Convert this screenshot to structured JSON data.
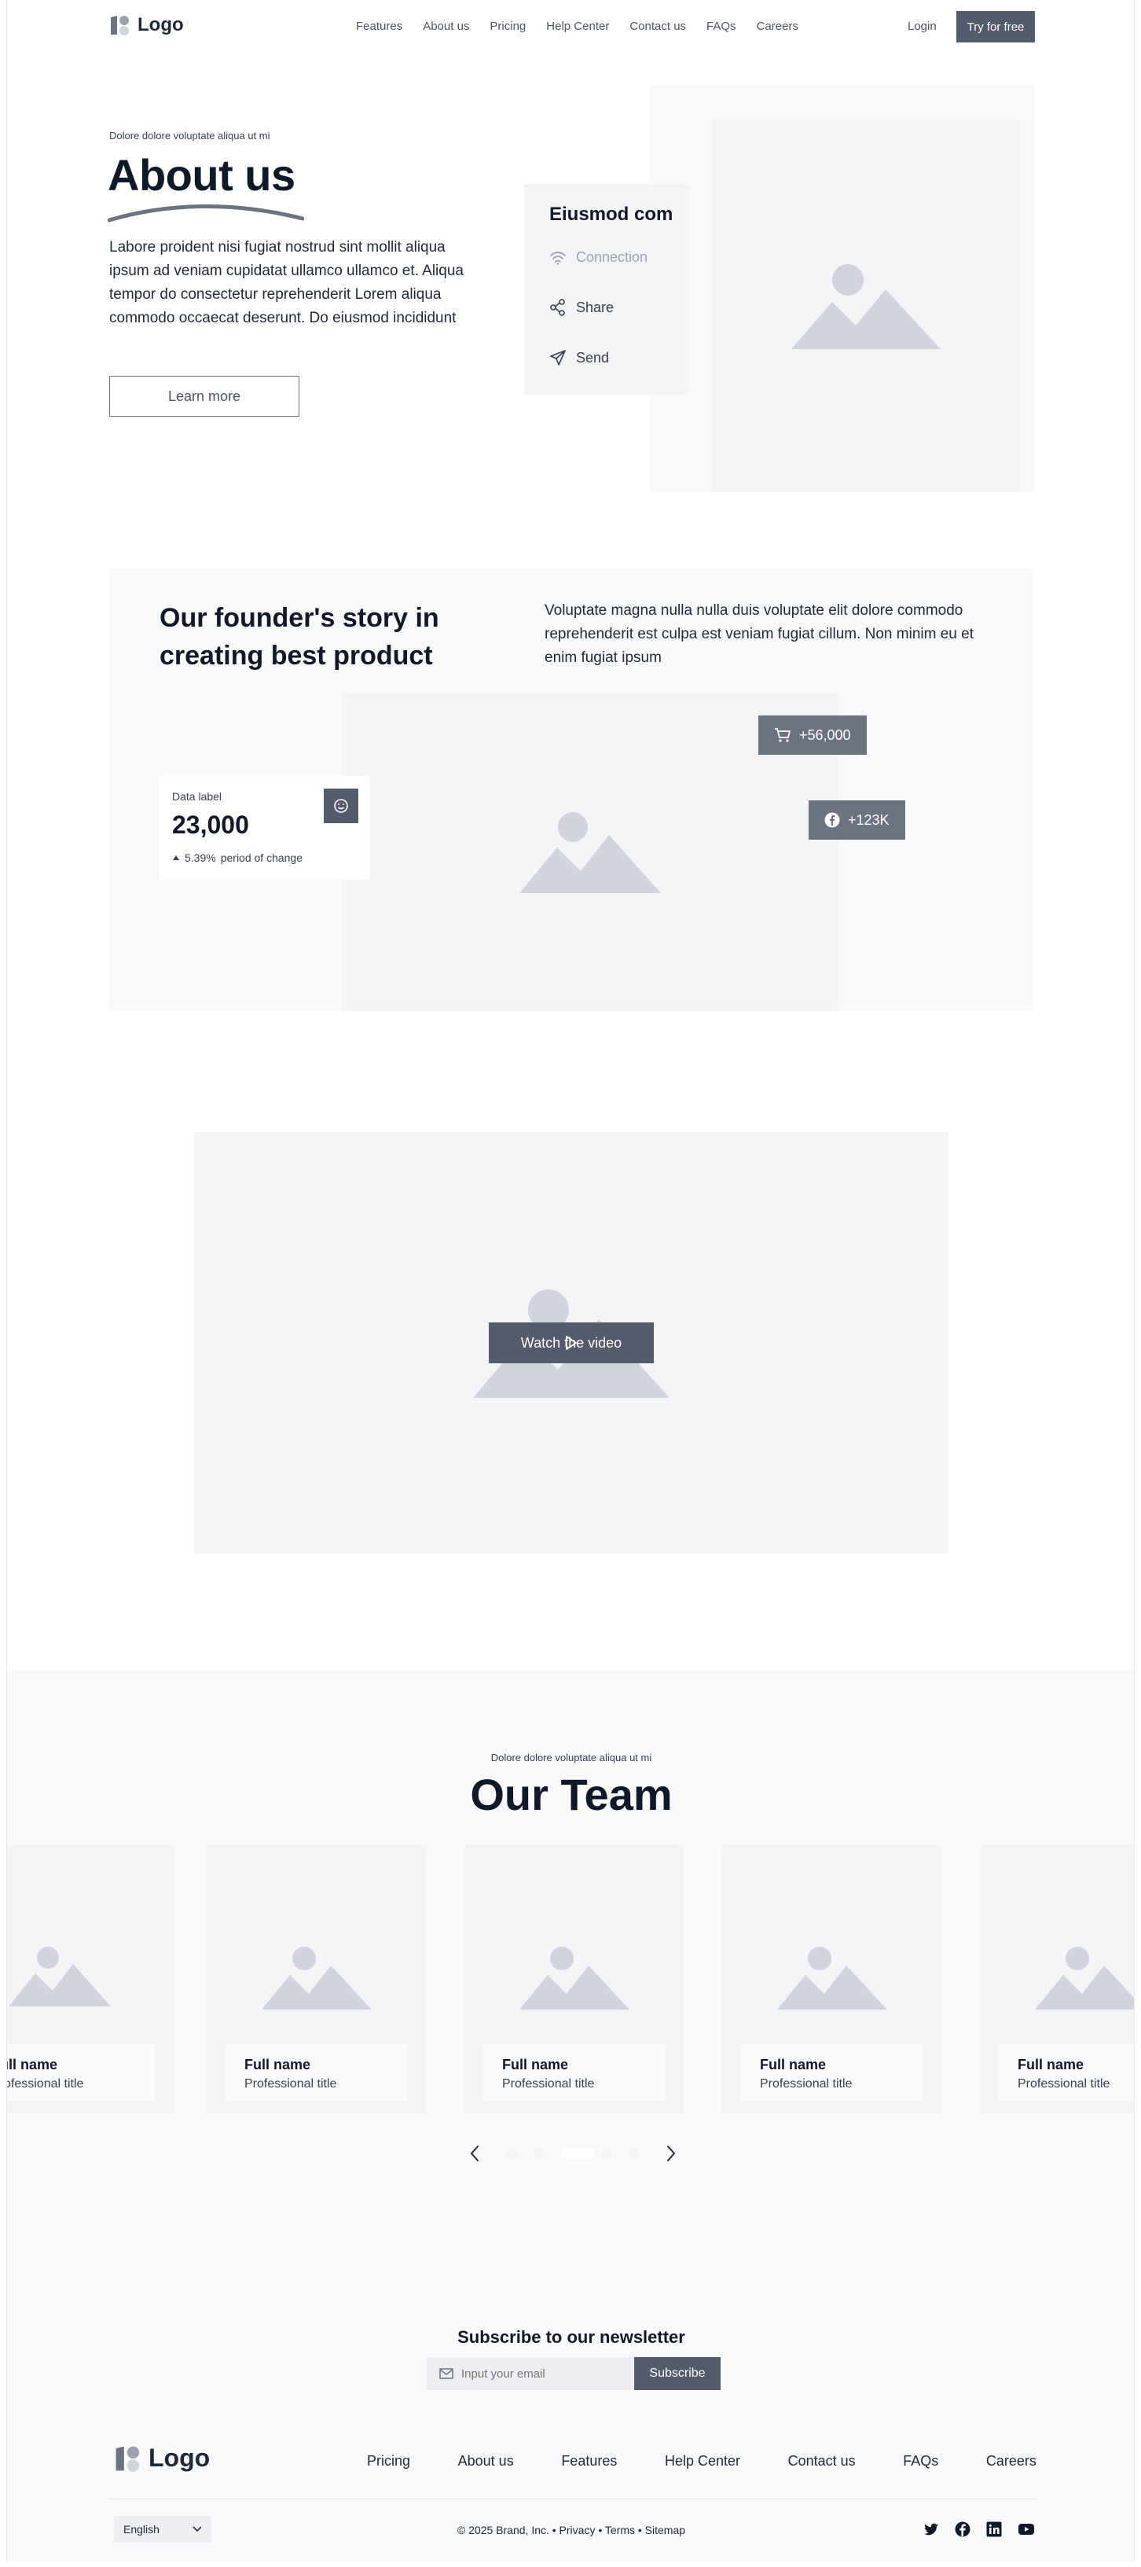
{
  "nav": {
    "logo": "Logo",
    "links": [
      "Features",
      "About us",
      "Pricing",
      "Help Center",
      "Contact us",
      "FAQs",
      "Careers"
    ],
    "login": "Login",
    "cta": "Try for free"
  },
  "hero": {
    "eyebrow": "Dolore dolore voluptate aliqua ut mi",
    "title": "About us",
    "body": "Labore proident nisi fugiat nostrud sint mollit aliqua ipsum ad veniam cupidatat ullamco ullamco et. Aliqua tempor do consectetur reprehenderit Lorem aliqua commodo occaecat deserunt. Do eiusmod incididunt",
    "button": "Learn more",
    "card": {
      "title": "Eiusmod com",
      "items": [
        {
          "icon": "wifi-icon",
          "label": "Connection"
        },
        {
          "icon": "share-icon",
          "label": "Share"
        },
        {
          "icon": "send-icon",
          "label": "Send"
        }
      ]
    }
  },
  "founder": {
    "title": "Our founder's story in creating best product",
    "body": "Voluptate magna nulla nulla duis voluptate elit dolore commodo reprehenderit est culpa est veniam fugiat cillum. Non minim eu et enim fugiat ipsum",
    "stat": {
      "label": "Data label",
      "value": "23,000",
      "change": "5.39%",
      "change_text": "period of change"
    },
    "pill_cart": "+56,000",
    "pill_facebook": "+123K"
  },
  "video": {
    "button": "Watch the video"
  },
  "team": {
    "eyebrow": "Dolore dolore voluptate aliqua ut mi",
    "title": "Our Team",
    "members": [
      {
        "name": "Full name",
        "title": "Professional title"
      },
      {
        "name": "Full name",
        "title": "Professional title"
      },
      {
        "name": "Full name",
        "title": "Professional title"
      },
      {
        "name": "Full name",
        "title": "Professional title"
      },
      {
        "name": "Full name",
        "title": "Professional title"
      }
    ],
    "carousel_active_index": 2
  },
  "newsletter": {
    "title": "Subscribe to our newsletter",
    "placeholder": "Input your email",
    "button": "Subscribe"
  },
  "footer": {
    "logo": "Logo",
    "links": [
      "Pricing",
      "About us",
      "Features",
      "Help Center",
      "Contact us",
      "FAQs",
      "Careers"
    ],
    "language": "English",
    "copyright": "© 2025 Brand, Inc. • Privacy • Terms • Sitemap",
    "social": [
      "twitter-icon",
      "facebook-icon",
      "linkedin-icon",
      "youtube-icon"
    ]
  },
  "colors": {
    "accent": "#545b6b",
    "placeholder_bg": "#f3f4f6",
    "section_bg": "#f8f9fa",
    "icon_gray": "#d1d5db"
  }
}
